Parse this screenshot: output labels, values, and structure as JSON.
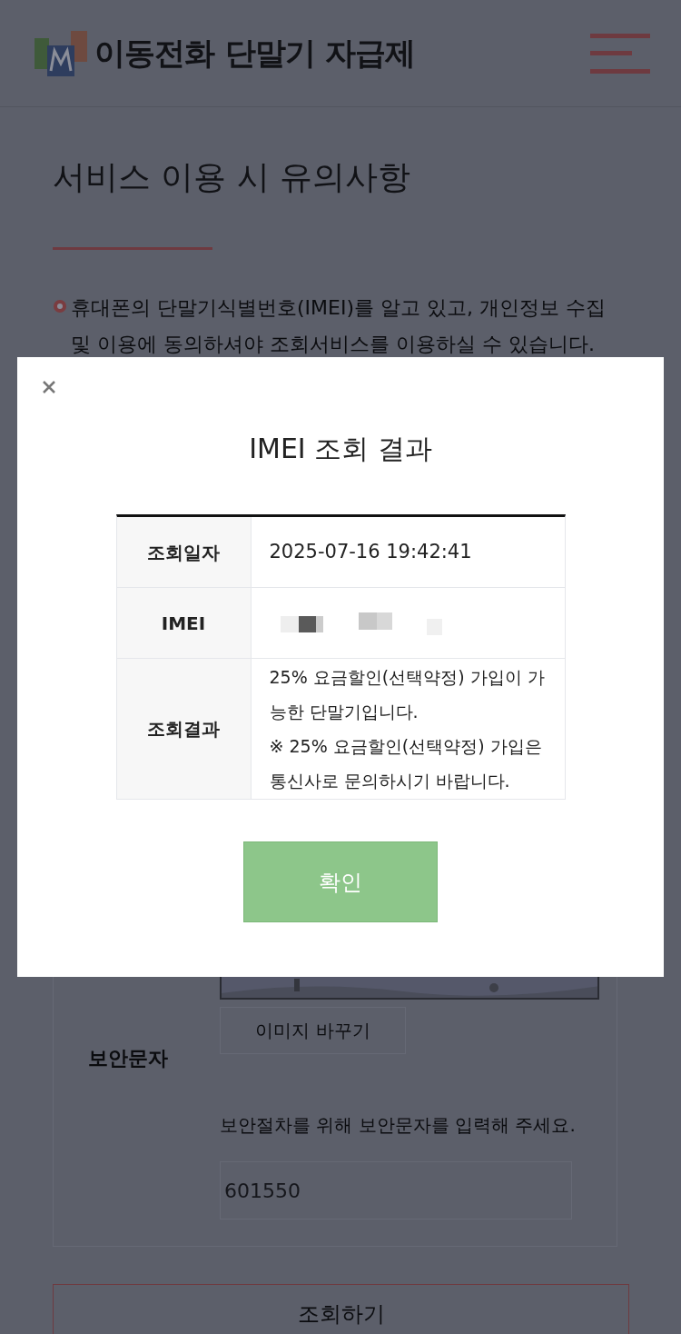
{
  "header": {
    "logo_text": "이동전화 단말기 자급제"
  },
  "page_title": "서비스 이용 시 유의사항",
  "notice": "휴대폰의 단말기식별번호(IMEI)를 알고 있고, 개인정보 수집 및 이용에 동의하셔야 조회서비스를 이용하실 수 있습니다.",
  "captcha": {
    "refresh_button": "이미지 바꾸기",
    "label": "보안문자",
    "instruction": "보안절차를 위해 보안문자를 입력해 주세요.",
    "value": "601550"
  },
  "submit_button": "조회하기",
  "modal": {
    "title": "IMEI 조회 결과",
    "rows": [
      {
        "label": "조회일자",
        "kind": "text",
        "value": "2025-07-16 19:42:41"
      },
      {
        "label": "IMEI",
        "kind": "redacted"
      },
      {
        "label": "조회결과",
        "kind": "lines",
        "lines": [
          "25% 요금할인(선택약정) 가입이 가능한 단말기입니다.",
          "※ 25% 요금할인(선택약정) 가입은 통신사로 문의하시기 바랍니다."
        ]
      }
    ],
    "confirm_button": "확인"
  }
}
